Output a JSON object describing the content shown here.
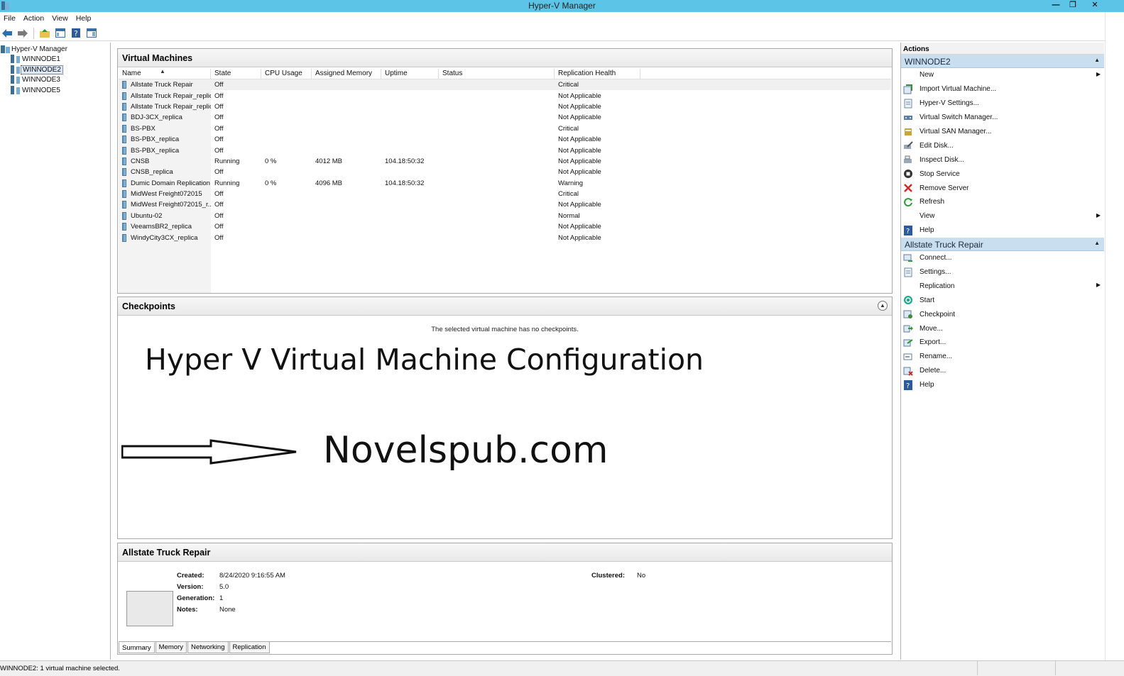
{
  "window": {
    "title": "Hyper-V Manager"
  },
  "menu": [
    "File",
    "Action",
    "View",
    "Help"
  ],
  "tree": {
    "root": "Hyper-V Manager",
    "nodes": [
      "WINNODE1",
      "WINNODE2",
      "WINNODE3",
      "WINNODE5"
    ]
  },
  "vms": {
    "title": "Virtual Machines",
    "columns": [
      "Name",
      "State",
      "CPU Usage",
      "Assigned Memory",
      "Uptime",
      "Status",
      "Replication Health"
    ],
    "rows": [
      [
        "Allstate Truck Repair",
        "Off",
        "",
        "",
        "",
        "",
        "Critical"
      ],
      [
        "Allstate Truck Repair_replica",
        "Off",
        "",
        "",
        "",
        "",
        "Not Applicable"
      ],
      [
        "Allstate Truck Repair_replica",
        "Off",
        "",
        "",
        "",
        "",
        "Not Applicable"
      ],
      [
        "BDJ-3CX_replica",
        "Off",
        "",
        "",
        "",
        "",
        "Not Applicable"
      ],
      [
        "BS-PBX",
        "Off",
        "",
        "",
        "",
        "",
        "Critical"
      ],
      [
        "BS-PBX_replica",
        "Off",
        "",
        "",
        "",
        "",
        "Not Applicable"
      ],
      [
        "BS-PBX_replica",
        "Off",
        "",
        "",
        "",
        "",
        "Not Applicable"
      ],
      [
        "CNSB",
        "Running",
        "0 %",
        "4012 MB",
        "104.18:50:32",
        "",
        "Not Applicable"
      ],
      [
        "CNSB_replica",
        "Off",
        "",
        "",
        "",
        "",
        "Not Applicable"
      ],
      [
        "Dumic Domain Replication",
        "Running",
        "0 %",
        "4096 MB",
        "104.18:50:32",
        "",
        "Warning"
      ],
      [
        "MidWest Freight072015",
        "Off",
        "",
        "",
        "",
        "",
        "Critical"
      ],
      [
        "MidWest Freight072015_r...",
        "Off",
        "",
        "",
        "",
        "",
        "Not Applicable"
      ],
      [
        "Ubuntu-02",
        "Off",
        "",
        "",
        "",
        "",
        "Normal"
      ],
      [
        "VeeamsBR2_replica",
        "Off",
        "",
        "",
        "",
        "",
        "Not Applicable"
      ],
      [
        "WindyCity3CX_replica",
        "Off",
        "",
        "",
        "",
        "",
        "Not Applicable"
      ]
    ]
  },
  "checkpoints": {
    "title": "Checkpoints",
    "empty_message": "The selected virtual machine has no checkpoints.",
    "overlay_title": "Hyper V Virtual Machine Configuration",
    "overlay_site": "Novelspub.com"
  },
  "details": {
    "title": "Allstate Truck Repair",
    "created_label": "Created:",
    "created": "8/24/2020 9:16:55 AM",
    "version_label": "Version:",
    "version": "5.0",
    "generation_label": "Generation:",
    "generation": "1",
    "notes_label": "Notes:",
    "notes": "None",
    "clustered_label": "Clustered:",
    "clustered": "No",
    "tabs": [
      "Summary",
      "Memory",
      "Networking",
      "Replication"
    ]
  },
  "actions": {
    "header": "Actions",
    "host_section": "WINNODE2",
    "host_items": [
      {
        "label": "New",
        "icon": "none",
        "submenu": true
      },
      {
        "label": "Import Virtual Machine...",
        "icon": "import-icon"
      },
      {
        "label": "Hyper-V Settings...",
        "icon": "settings-icon"
      },
      {
        "label": "Virtual Switch Manager...",
        "icon": "switch-icon"
      },
      {
        "label": "Virtual SAN Manager...",
        "icon": "san-icon"
      },
      {
        "label": "Edit Disk...",
        "icon": "edit-disk-icon"
      },
      {
        "label": "Inspect Disk...",
        "icon": "inspect-disk-icon"
      },
      {
        "label": "Stop Service",
        "icon": "stop-icon"
      },
      {
        "label": "Remove Server",
        "icon": "remove-icon"
      },
      {
        "label": "Refresh",
        "icon": "refresh-icon"
      },
      {
        "label": "View",
        "icon": "none",
        "submenu": true
      },
      {
        "label": "Help",
        "icon": "help-icon"
      }
    ],
    "vm_section": "Allstate Truck Repair",
    "vm_items": [
      {
        "label": "Connect...",
        "icon": "connect-icon"
      },
      {
        "label": "Settings...",
        "icon": "settings-icon"
      },
      {
        "label": "Replication",
        "icon": "none",
        "submenu": true
      },
      {
        "label": "Start",
        "icon": "start-icon"
      },
      {
        "label": "Checkpoint",
        "icon": "checkpoint-icon"
      },
      {
        "label": "Move...",
        "icon": "move-icon"
      },
      {
        "label": "Export...",
        "icon": "export-icon"
      },
      {
        "label": "Rename...",
        "icon": "rename-icon"
      },
      {
        "label": "Delete...",
        "icon": "delete-icon"
      },
      {
        "label": "Help",
        "icon": "help-icon"
      }
    ]
  },
  "status": {
    "text": "WINNODE2:  1 virtual machine selected."
  },
  "colors": {
    "titlebar": "#5cc4e6",
    "section_header": "#c9dff0",
    "selection": "#dbe9f7"
  }
}
